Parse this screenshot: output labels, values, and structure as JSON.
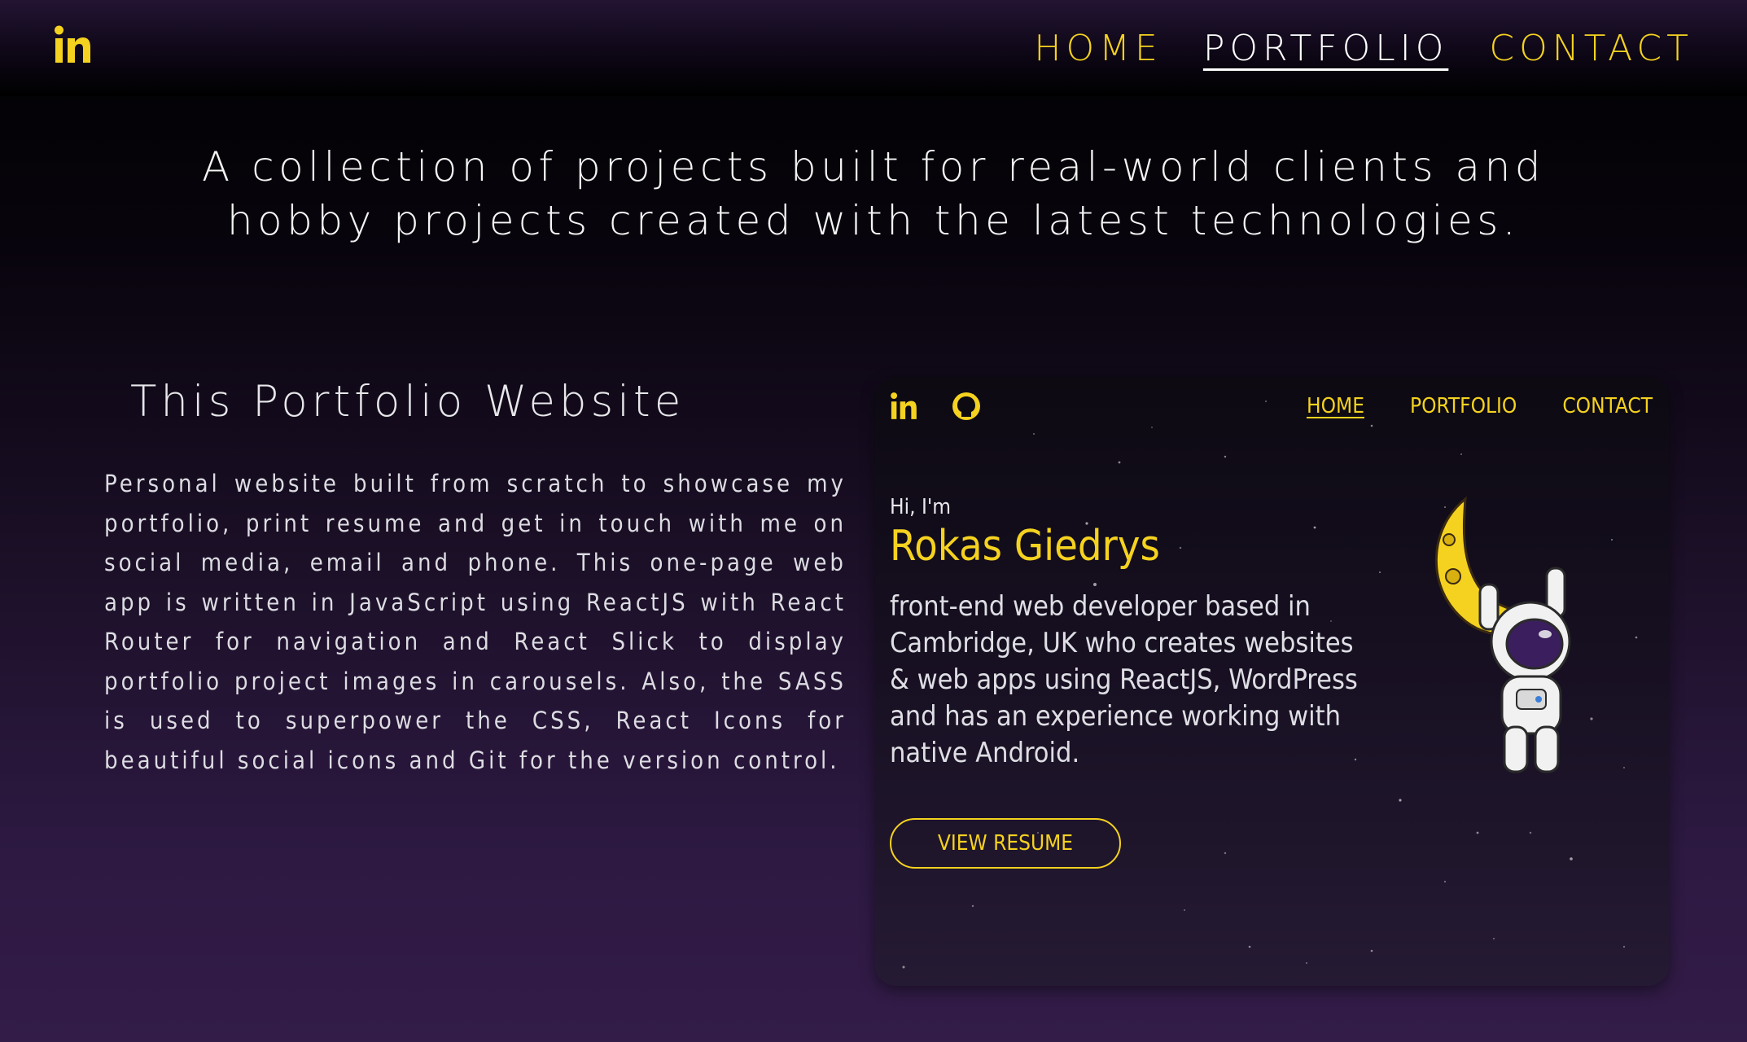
{
  "header": {
    "logo_icon": "linkedin-icon",
    "nav": [
      {
        "label": "HOME"
      },
      {
        "label": "PORTFOLIO"
      },
      {
        "label": "CONTACT"
      }
    ],
    "active_nav": "PORTFOLIO"
  },
  "intro": {
    "text": "A collection of projects built for real-world clients and hobby projects created with the latest technologies."
  },
  "project": {
    "title": "This Portfolio Website",
    "description": "Personal website built from scratch to showcase my portfolio, print resume and get in touch with me on social media, email and phone. This one-page web app is written in JavaScript using ReactJS with React Router for navigation and React Slick to display portfolio project images in carousels. Also, the SASS is used to superpower the CSS, React Icons for beautiful social icons and Git for the version control."
  },
  "preview": {
    "social_icons": [
      "linkedin-icon",
      "github-icon"
    ],
    "nav": [
      {
        "label": "HOME"
      },
      {
        "label": "PORTFOLIO"
      },
      {
        "label": "CONTACT"
      }
    ],
    "greeting": "Hi, I'm",
    "name": "Rokas Giedrys",
    "bio": "front-end web developer based in Cambridge, UK who creates websites & web apps using ReactJS, WordPress and has an experience working with native Android.",
    "resume_button": "VIEW RESUME",
    "illustration": "astronaut-on-moon"
  },
  "colors": {
    "accent": "#f5d21f",
    "background_top": "#000000",
    "background_bottom": "#331c48"
  }
}
